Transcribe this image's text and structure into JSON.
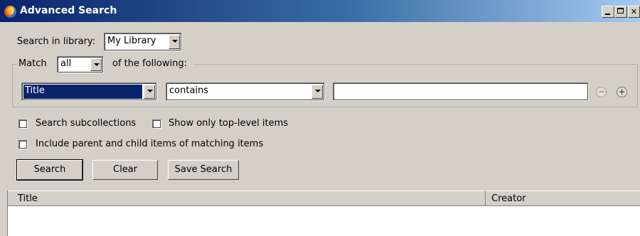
{
  "window": {
    "title": "Advanced Search",
    "icon": "firefox-icon"
  },
  "library": {
    "label": "Search in library:",
    "selected": "My Library"
  },
  "match": {
    "label": "Match",
    "mode": "all",
    "suffix": "of the following:"
  },
  "condition": {
    "field": "Title",
    "operator": "contains",
    "value": ""
  },
  "options": {
    "search_subcollections": {
      "label": "Search subcollections",
      "checked": false
    },
    "top_level_only": {
      "label": "Show only top-level items",
      "checked": false
    },
    "include_parent_child": {
      "label": "Include parent and child items of matching items",
      "checked": false
    }
  },
  "buttons": {
    "search": "Search",
    "clear": "Clear",
    "save_search": "Save Search"
  },
  "results": {
    "columns": [
      "Title",
      "Creator"
    ]
  },
  "colors": {
    "titlebar_start": "#0a246a",
    "titlebar_end": "#a6caf0",
    "selection": "#0a246a",
    "face": "#d4d0c8"
  }
}
